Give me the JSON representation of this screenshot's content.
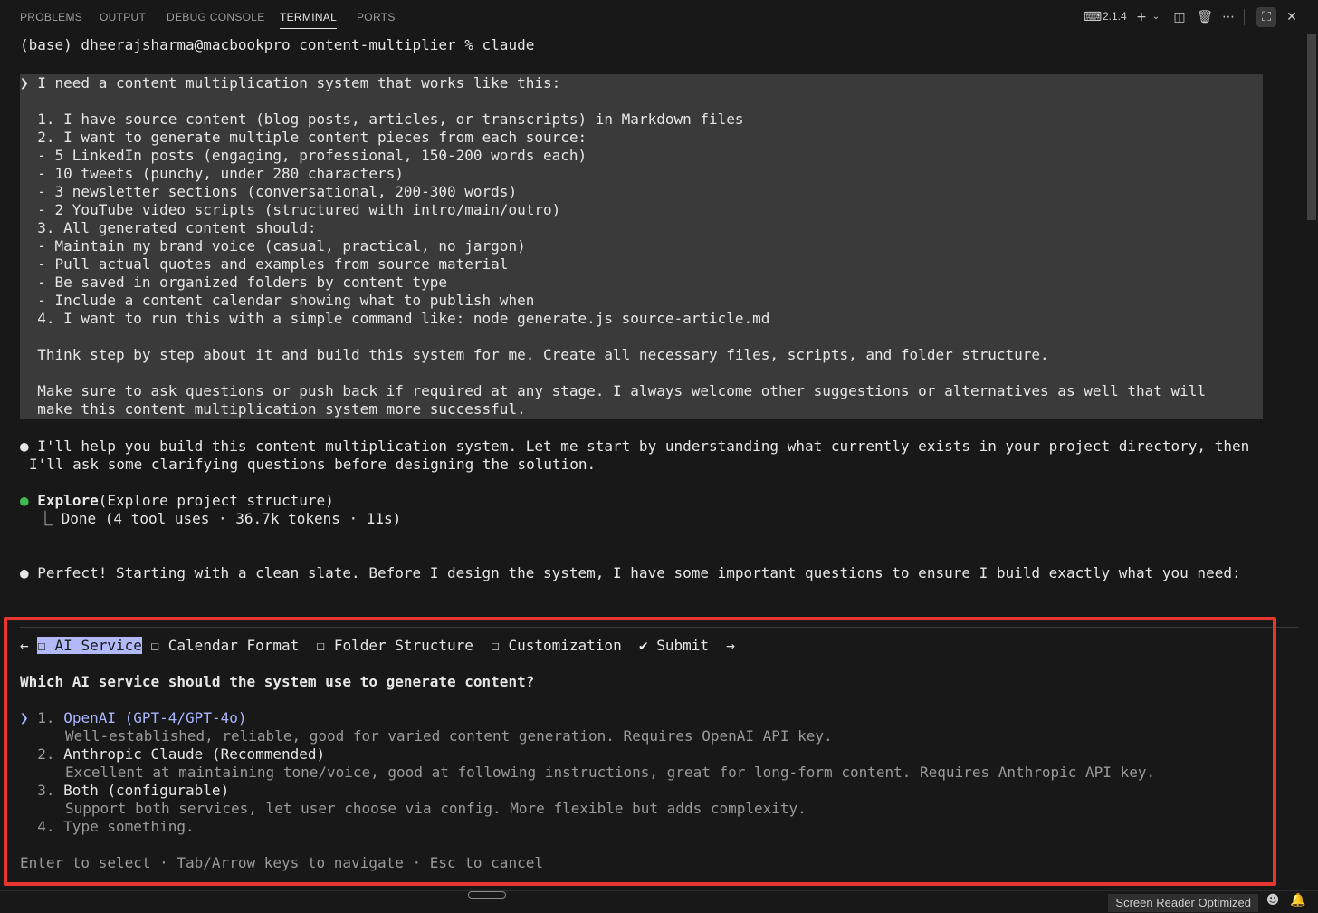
{
  "panel": {
    "tabs": [
      "PROBLEMS",
      "OUTPUT",
      "DEBUG CONSOLE",
      "TERMINAL",
      "PORTS"
    ],
    "active_tab": "TERMINAL",
    "terminal_version": "2.1.4"
  },
  "terminal": {
    "prompt_line": "(base) dheerajsharma@macbookpro content-multiplier % claude",
    "user_prompt": [
      "❯ I need a content multiplication system that works like this:",
      "",
      "  1. I have source content (blog posts, articles, or transcripts) in Markdown files",
      "  2. I want to generate multiple content pieces from each source:",
      "  - 5 LinkedIn posts (engaging, professional, 150-200 words each)",
      "  - 10 tweets (punchy, under 280 characters)",
      "  - 3 newsletter sections (conversational, 200-300 words)",
      "  - 2 YouTube video scripts (structured with intro/main/outro)",
      "  3. All generated content should:",
      "  - Maintain my brand voice (casual, practical, no jargon)",
      "  - Pull actual quotes and examples from source material",
      "  - Be saved in organized folders by content type",
      "  - Include a content calendar showing what to publish when",
      "  4. I want to run this with a simple command like: node generate.js source-article.md",
      "",
      "  Think step by step about it and build this system for me. Create all necessary files, scripts, and folder structure.",
      "",
      "  Make sure to ask questions or push back if required at any stage. I always welcome other suggestions or alternatives as well that will",
      "  make this content multiplication system more successful."
    ],
    "assistant_msg_1": [
      "I'll help you build this content multiplication system. Let me start by understanding what currently exists in your project directory, then",
      "I'll ask some clarifying questions before designing the solution."
    ],
    "tool": {
      "name": "Explore",
      "args": "(Explore project structure)",
      "result": "⎿ Done (4 tool uses · 36.7k tokens · 11s)"
    },
    "assistant_msg_2": "Perfect! Starting with a clean slate. Before I design the system, I have some important questions to ensure I build exactly what you need:"
  },
  "question_panel": {
    "nav_back": "←",
    "nav_forward": "→",
    "tabs": [
      "☐ AI Service",
      "☐ Calendar Format",
      "☐ Folder Structure",
      "☐ Customization",
      "✔ Submit"
    ],
    "question": "Which AI service should the system use to generate content?",
    "options": [
      {
        "num": "1.",
        "label": "OpenAI (GPT-4/GPT-4o)",
        "desc": "Well-established, reliable, good for varied content generation. Requires OpenAI API key."
      },
      {
        "num": "2.",
        "label": "Anthropic Claude (Recommended)",
        "desc": "Excellent at maintaining tone/voice, good at following instructions, great for long-form content. Requires Anthropic API key."
      },
      {
        "num": "3.",
        "label": "Both (configurable)",
        "desc": "Support both services, let user choose via config. More flexible but adds complexity."
      },
      {
        "num": "4.",
        "label": "Type something.",
        "desc": ""
      }
    ],
    "footer": "Enter to select · Tab/Arrow keys to navigate · Esc to cancel"
  },
  "statusbar": {
    "screen_reader": "Screen Reader Optimized"
  },
  "colors": {
    "background": "#181818",
    "prompt_block": "#3a3a3a",
    "highlight_chip": "#b1b9f9",
    "selected_option": "#a8b5ff",
    "success_dot": "#3fb950",
    "annotation_box": "#e8362f"
  }
}
